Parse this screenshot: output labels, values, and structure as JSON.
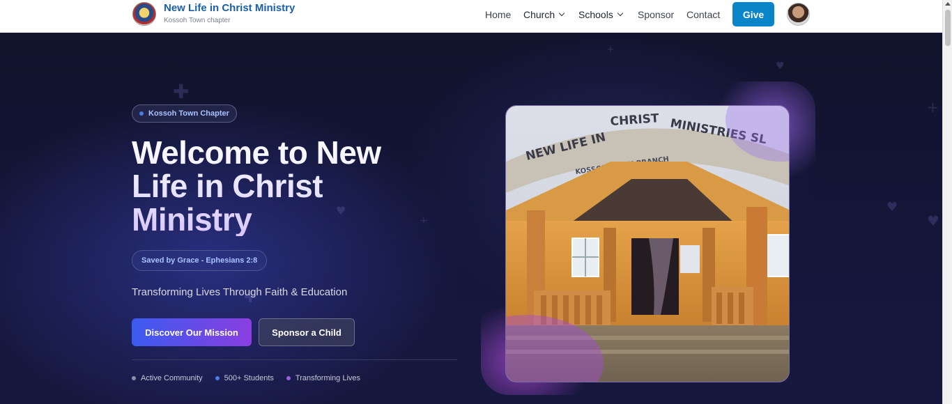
{
  "header": {
    "brand_title": "New Life in Christ Ministry",
    "brand_subtitle": "Kossoh Town chapter",
    "nav": [
      {
        "label": "Home"
      },
      {
        "label": "Church"
      },
      {
        "label": "Schools"
      },
      {
        "label": "Sponsor"
      },
      {
        "label": "Contact"
      }
    ],
    "give_label": "Give"
  },
  "hero": {
    "chapter_badge": "Kossoh Town Chapter",
    "title": "Welcome to New Life in Christ Ministry",
    "verse_badge": "Saved by Grace - Ephesians 2:8",
    "tagline": "Transforming Lives Through Faith & Education",
    "primary_button": "Discover Our Mission",
    "secondary_button": "Sponsor a Child",
    "stats": [
      {
        "label": "Active Community",
        "dot_color": "#8a8fa8"
      },
      {
        "label": "500+ Students",
        "dot_color": "#4f7be8"
      },
      {
        "label": "Transforming Lives",
        "dot_color": "#9a5fe0"
      }
    ],
    "photo_sign_text": "NEW LIFE IN CHRIST MINISTRIES SL",
    "photo_sub_sign_text": "KOSSOH TOWN BRANCH"
  },
  "colors": {
    "brand_blue": "#1b5fa8",
    "give_blue": "#0a84c9",
    "badge_text": "#a9c3ff",
    "chapter_dot": "#4f7be8"
  },
  "icons": [
    "logo-seal-icon",
    "chevron-down-icon",
    "avatar-image",
    "cross-icon",
    "heart-icon"
  ]
}
